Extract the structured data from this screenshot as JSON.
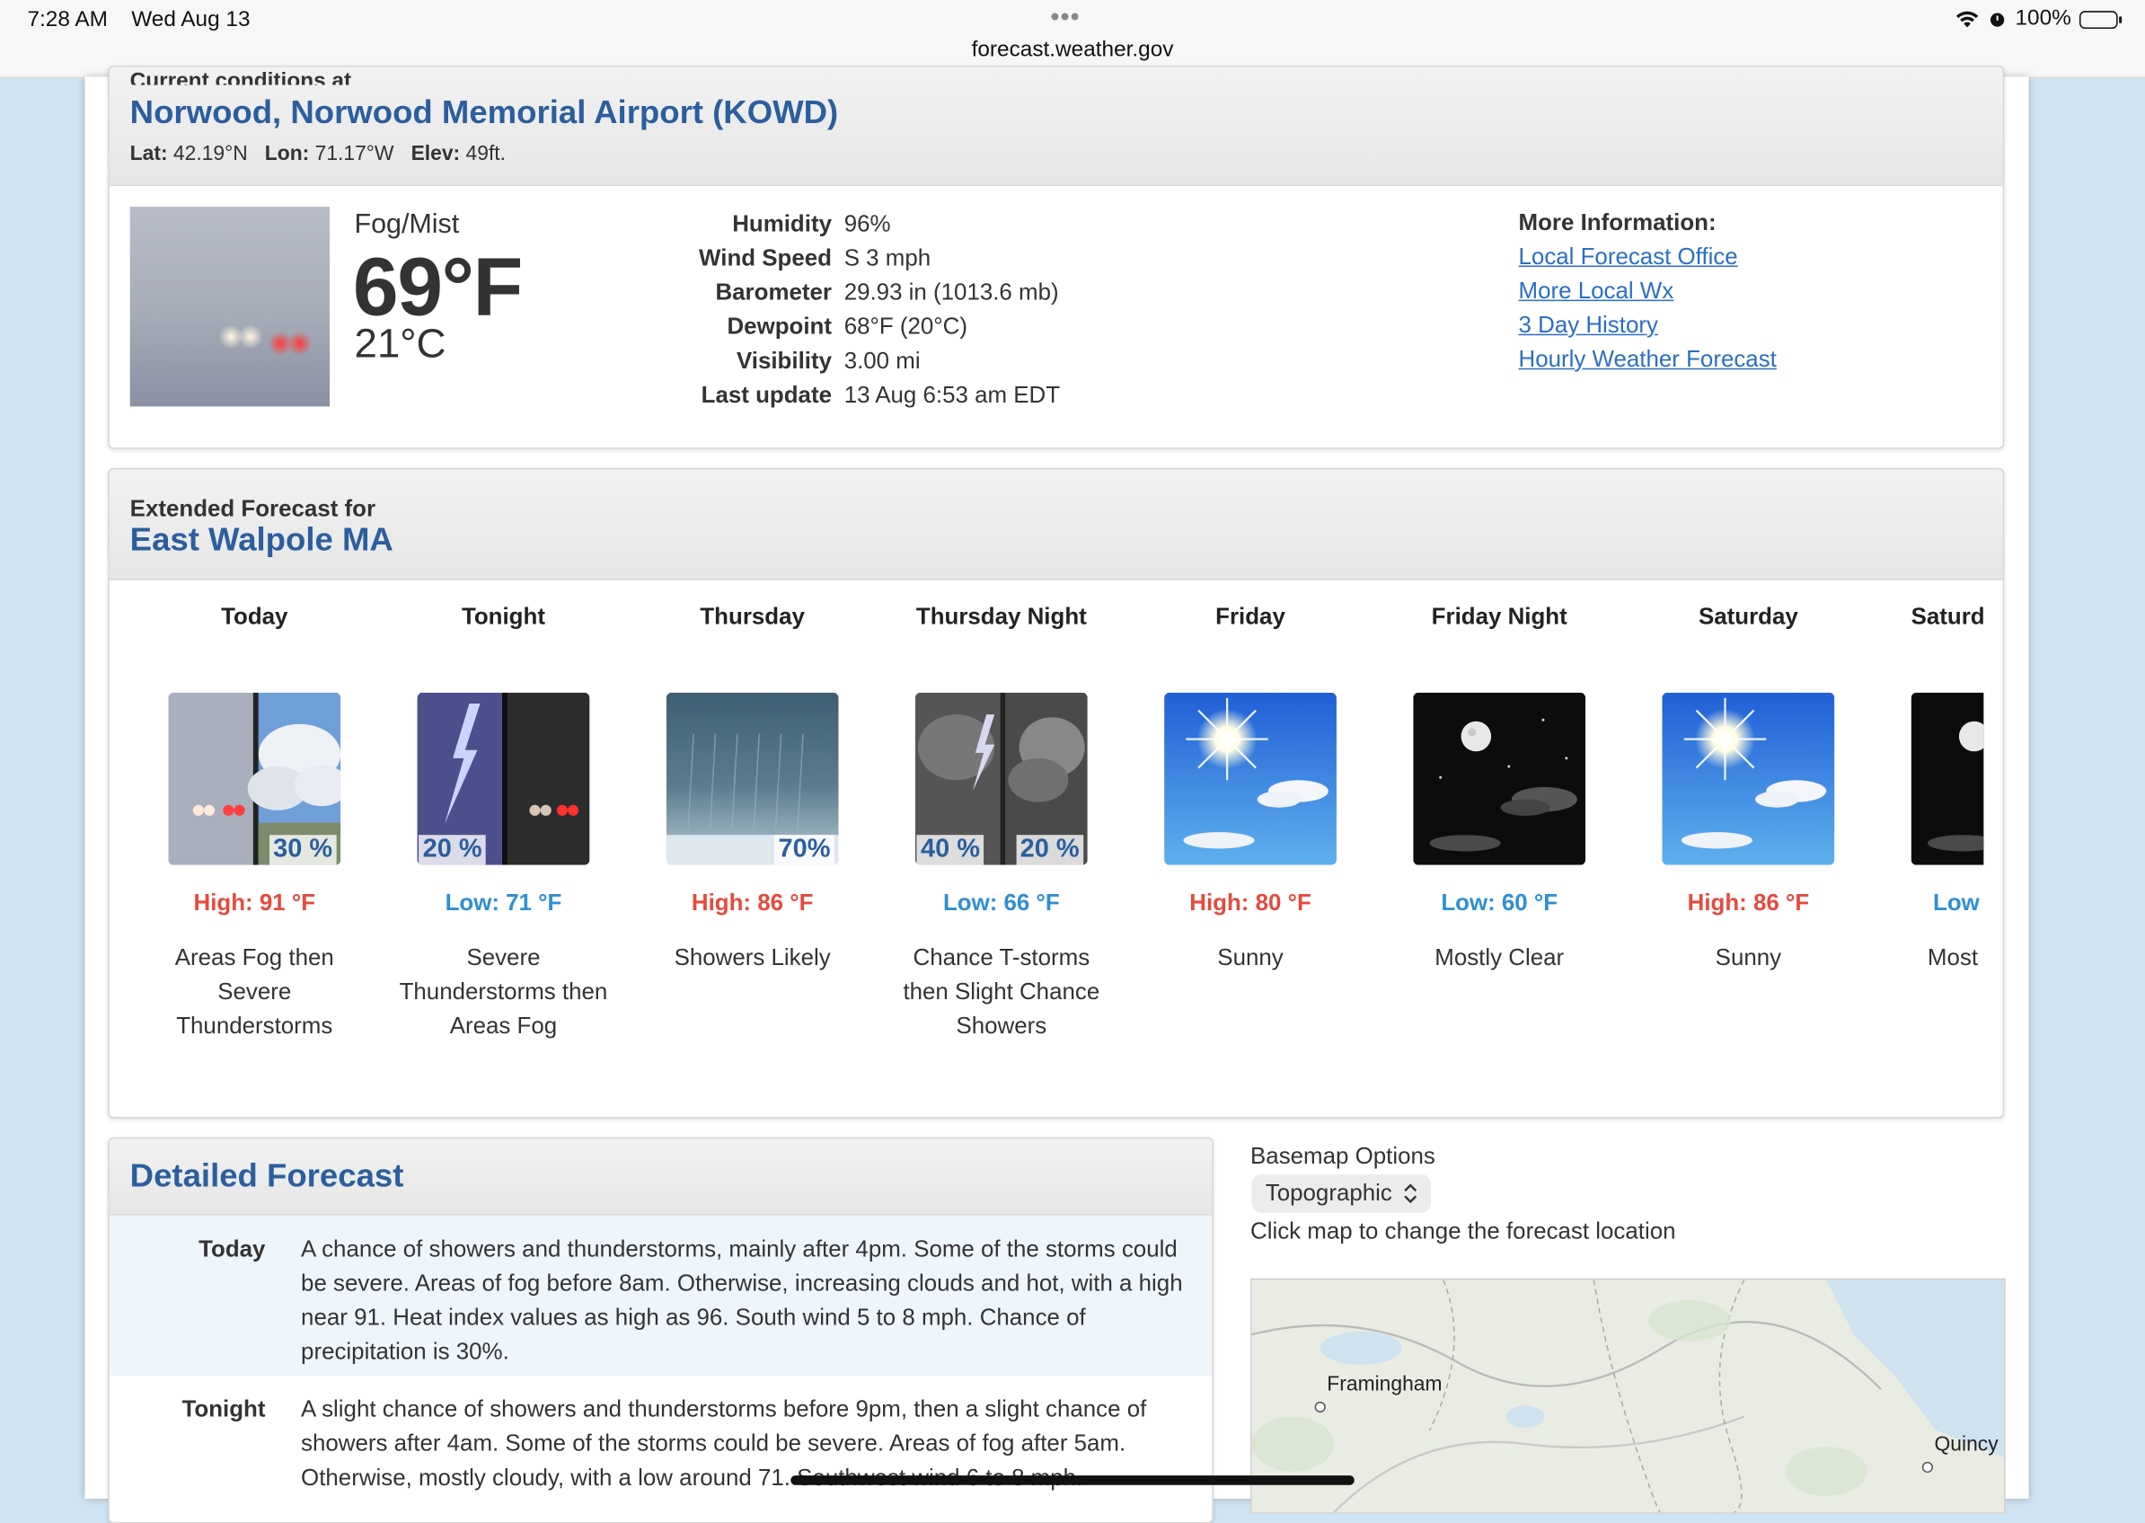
{
  "statusbar": {
    "time": "7:28 AM",
    "date": "Wed Aug 13",
    "url": "forecast.weather.gov",
    "battery": "100%"
  },
  "current": {
    "label": "Current conditions at",
    "station": "Norwood, Norwood Memorial Airport (KOWD)",
    "lat_label": "Lat:",
    "lat": "42.19°N",
    "lon_label": "Lon:",
    "lon": "71.17°W",
    "elev_label": "Elev:",
    "elev": "49ft.",
    "condition": "Fog/Mist",
    "temp_f": "69°F",
    "temp_c": "21°C",
    "details": [
      {
        "key": "Humidity",
        "value": "96%"
      },
      {
        "key": "Wind Speed",
        "value": "S 3 mph"
      },
      {
        "key": "Barometer",
        "value": "29.93 in (1013.6 mb)"
      },
      {
        "key": "Dewpoint",
        "value": "68°F (20°C)"
      },
      {
        "key": "Visibility",
        "value": "3.00 mi"
      },
      {
        "key": "Last update",
        "value": "13 Aug 6:53 am EDT"
      }
    ],
    "more_info_title": "More Information:",
    "more_info_links": [
      "Local Forecast Office",
      "More Local Wx",
      "3 Day History",
      "Hourly Weather Forecast"
    ]
  },
  "extended": {
    "label": "Extended Forecast for",
    "location": "East Walpole MA",
    "periods": [
      {
        "name": "Today",
        "temp": "High: 91 °F",
        "short": "Areas Fog then Severe Thunderstorms",
        "pop": "30 %"
      },
      {
        "name": "Tonight",
        "temp": "Low: 71 °F",
        "short": "Severe Thunderstorms then Areas Fog",
        "pop": "20 %"
      },
      {
        "name": "Thursday",
        "temp": "High: 86 °F",
        "short": "Showers Likely",
        "pop": "70%"
      },
      {
        "name": "Thursday Night",
        "temp": "Low: 66 °F",
        "short": "Chance T-storms then Slight Chance Showers",
        "pop": "40 %",
        "pop2": "20 %"
      },
      {
        "name": "Friday",
        "temp": "High: 80 °F",
        "short": "Sunny"
      },
      {
        "name": "Friday Night",
        "temp": "Low: 60 °F",
        "short": "Mostly Clear"
      },
      {
        "name": "Saturday",
        "temp": "High: 86 °F",
        "short": "Sunny"
      },
      {
        "name": "Saturd",
        "temp": "Low",
        "short": "Most"
      }
    ]
  },
  "detailed": {
    "title": "Detailed Forecast",
    "rows": [
      {
        "name": "Today",
        "text": "A chance of showers and thunderstorms, mainly after 4pm. Some of the storms could be severe. Areas of fog before 8am. Otherwise, increasing clouds and hot, with a high near 91. Heat index values as high as 96. South wind 5 to 8 mph. Chance of precipitation is 30%."
      },
      {
        "name": "Tonight",
        "text": "A slight chance of showers and thunderstorms before 9pm, then a slight chance of showers after 4am. Some of the storms could be severe. Areas of fog after 5am. Otherwise, mostly cloudy, with a low around 71. Southwest wind 6 to 8 mph."
      }
    ]
  },
  "map": {
    "basemap_label": "Basemap Options",
    "basemap_value": "Topographic",
    "hint": "Click map to change the forecast location",
    "labels": [
      "Framingham",
      "Quincy"
    ]
  },
  "colors": {
    "title_blue": "#2c5e9e",
    "link_blue": "#2a6fc4",
    "high_red": "#e64a3c",
    "low_blue": "#2e8fd3"
  }
}
